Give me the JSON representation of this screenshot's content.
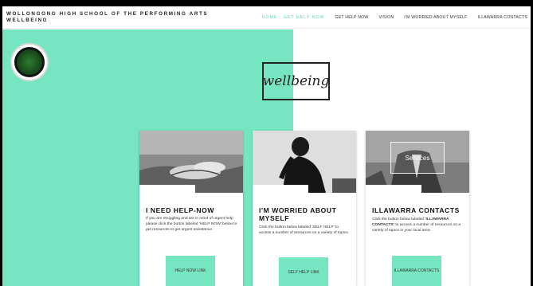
{
  "header": {
    "title_line1": "WOLLONGONG HIGH SCHOOL OF THE PERFORMING ARTS",
    "title_line2": "WELLBEING"
  },
  "nav": {
    "items": [
      {
        "label": "HOME - GET HELP NOW",
        "active": true
      },
      {
        "label": "GET HELP NOW",
        "active": false
      },
      {
        "label": "VISION",
        "active": false
      },
      {
        "label": "I'M WORRIED ABOUT MYSELF",
        "active": false
      },
      {
        "label": "ILLAWARRA CONTACTS",
        "active": false
      }
    ]
  },
  "hero": {
    "wellbeing_label": "wellbeing"
  },
  "colors": {
    "mint": "#76e6c2"
  },
  "cards": [
    {
      "title": "I NEED HELP-NOW",
      "body": "If you are struggling and are in need of urgent help please click the button labeled 'HELP NOW' below to get resources to get urgent assistance.",
      "button": "HELP NOW LINK"
    },
    {
      "title": "I'M WORRIED ABOUT MYSELF",
      "body": "Click the button below labeled 'SELF HELP' to access a number of resources on a variety of topics.",
      "button": "SELF HELP LINK"
    },
    {
      "title": "ILLAWARRA CONTACTS",
      "body_part1": "Click the button below labeled ",
      "body_bold": "'ILLAWARRA CONTACTS'",
      "body_part2": " to access a number of resources on a variety of topics in your local area.",
      "button": "ILLAWARRA CONTACTS",
      "image_label": "Services"
    }
  ]
}
